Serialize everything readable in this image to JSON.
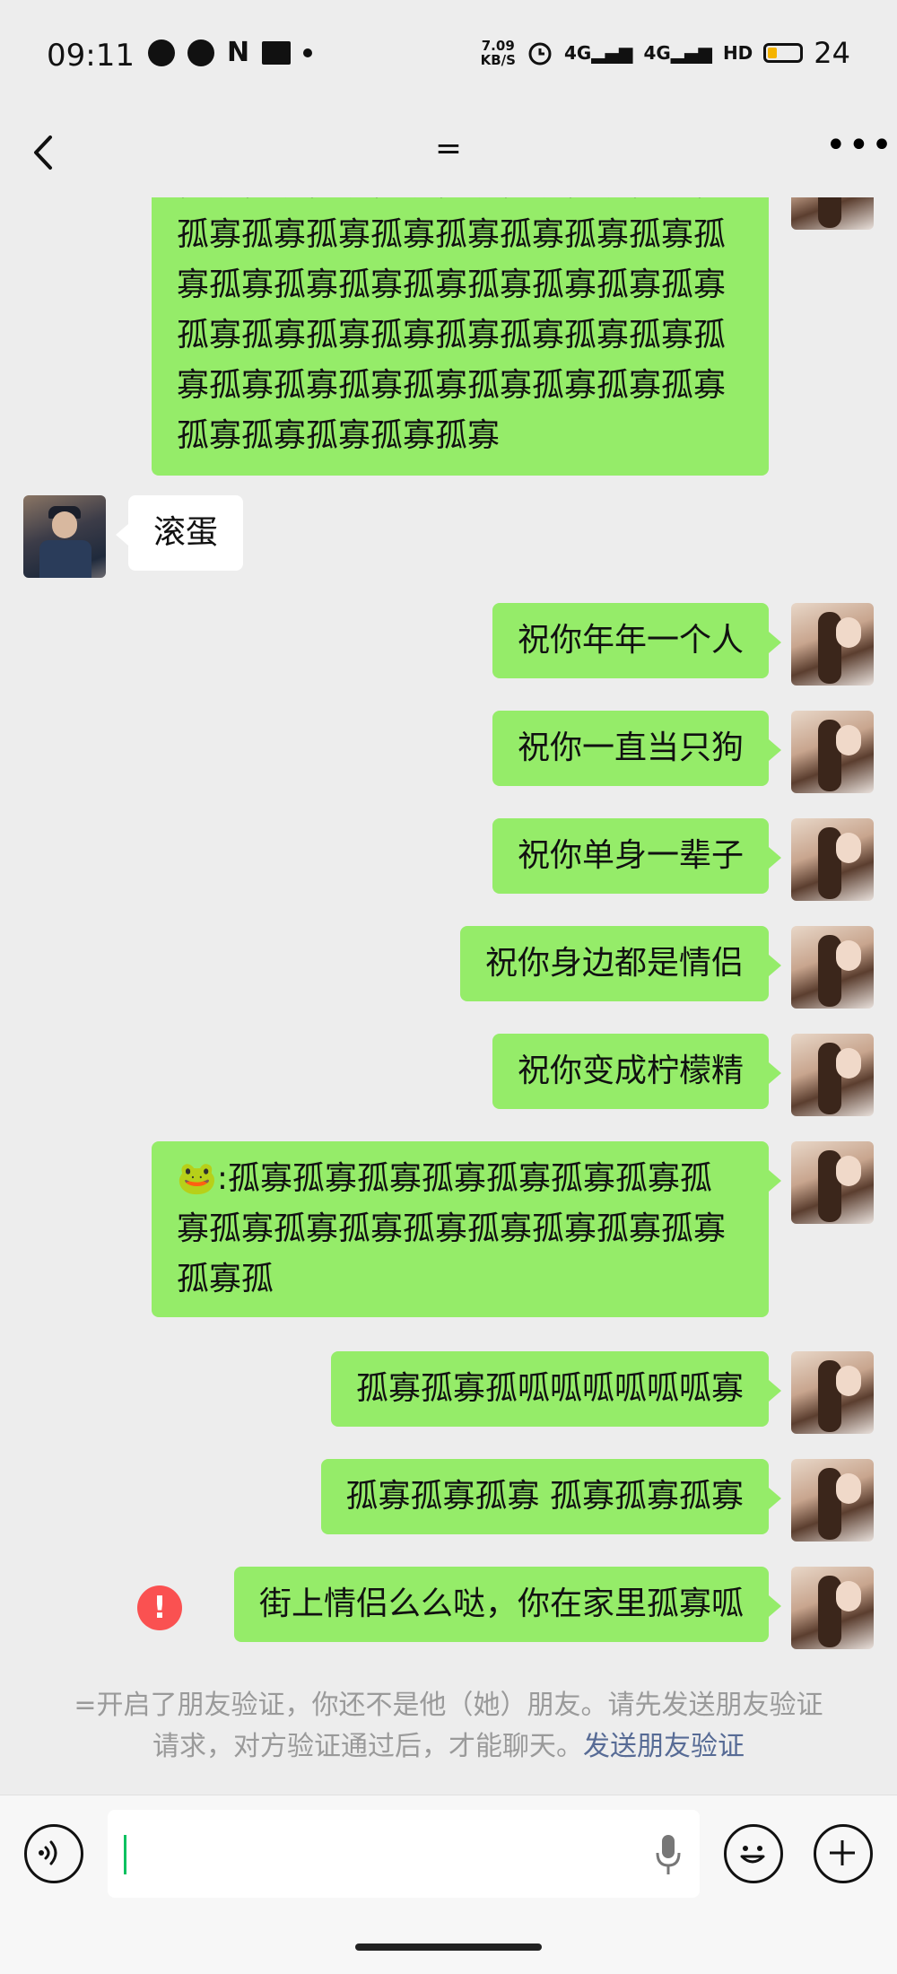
{
  "status_bar": {
    "time": "09:11",
    "speed_value": "7.09",
    "speed_unit": "KB/S",
    "signal1": "4G",
    "signal2": "4G",
    "hd": "HD",
    "battery": "24"
  },
  "nav": {
    "title": "="
  },
  "messages": [
    {
      "side": "me",
      "text": "寡孤寡孤寡孤寡孤寡孤寡孤寡孤寡孤寡孤寡孤寡孤寡孤寡孤寡孤寡孤寡孤寡孤寡孤寡孤寡孤寡孤寡孤寡孤寡孤寡孤寡孤寡孤寡孤寡孤寡孤寡孤寡孤寡孤寡孤寡孤寡孤寡孤寡孤寡孤寡孤寡孤寡孤寡孤寡孤寡孤寡孤寡孤寡"
    },
    {
      "side": "other",
      "text": "滚蛋"
    },
    {
      "side": "me",
      "text": "祝你年年一个人"
    },
    {
      "side": "me",
      "text": "祝你一直当只狗"
    },
    {
      "side": "me",
      "text": "祝你单身一辈子"
    },
    {
      "side": "me",
      "text": "祝你身边都是情侣"
    },
    {
      "side": "me",
      "text": "祝你变成柠檬精"
    },
    {
      "side": "me",
      "emoji": "🐸",
      "text": ":孤寡孤寡孤寡孤寡孤寡孤寡孤寡孤寡孤寡孤寡孤寡孤寡孤寡孤寡孤寡孤寡孤寡孤"
    },
    {
      "side": "me",
      "text": "孤寡孤寡孤呱呱呱呱呱呱寡"
    },
    {
      "side": "me",
      "text": "孤寡孤寡孤寡 孤寡孤寡孤寡"
    },
    {
      "side": "me",
      "text": "街上情侣么么哒，你在家里孤寡呱",
      "failed": true,
      "failed_icon": "!"
    }
  ],
  "notice": {
    "text": "=开启了朋友验证，你还不是他（她）朋友。请先发送朋友验证请求，对方验证通过后，才能聊天。",
    "link": "发送朋友验证"
  },
  "input_bar": {
    "voice_icon": "voice-icon",
    "emoji_icon": "emoji-icon",
    "plus_icon": "plus-icon",
    "mic_icon": "mic-icon"
  }
}
